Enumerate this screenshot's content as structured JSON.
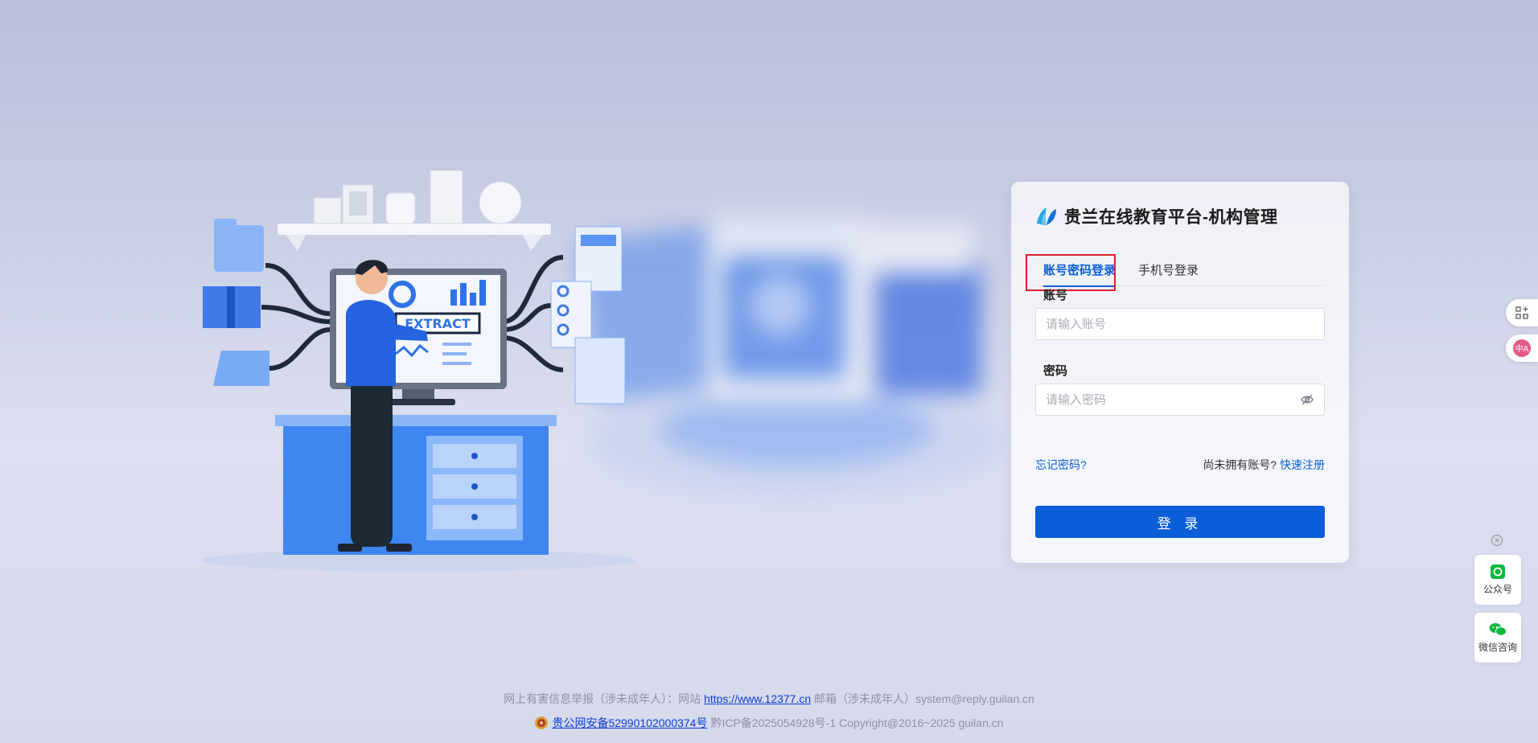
{
  "login": {
    "brand_title": "贵兰在线教育平台-机构管理",
    "tabs": [
      {
        "label": "账号密码登录",
        "active": true
      },
      {
        "label": "手机号登录",
        "active": false
      }
    ],
    "account_label": "账号",
    "account_placeholder": "请输入账号",
    "password_label": "密码",
    "password_placeholder": "请输入密码",
    "forgot_password": "忘记密码?",
    "no_account_text": "尚未拥有账号?",
    "quick_register": "快速注册",
    "login_button": "登 录"
  },
  "illustration": {
    "monitor_text": "EXTRACT"
  },
  "side_tools": [
    {
      "icon": "grid-plus-icon"
    },
    {
      "icon": "translate-icon"
    }
  ],
  "float_widgets": [
    {
      "icon": "official-account-icon",
      "label": "公众号"
    },
    {
      "icon": "wechat-icon",
      "label": "微信咨询"
    }
  ],
  "footer": {
    "report_prefix": "网上有害信息举报（涉未成年人）：网站",
    "report_link": "https://www.12377.cn",
    "email_text": "邮箱（涉未成年人）system@reply.guilan.cn",
    "police_record": "贵公网安备52990102000374号",
    "icp_copyright": "黔ICP备2025054928号-1 Copyright@2016~2025 guilan.cn"
  },
  "colors": {
    "primary": "#0b5ed7",
    "highlight_border": "#e0202a",
    "wechat_green": "#09b83e"
  }
}
